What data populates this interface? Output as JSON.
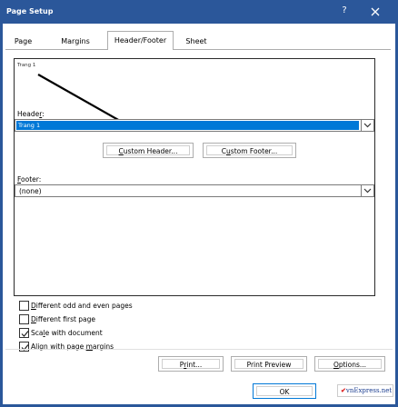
{
  "window": {
    "title": "Page Setup",
    "help_glyph": "?"
  },
  "tabs": [
    {
      "label": "Page"
    },
    {
      "label": "Margins"
    },
    {
      "label": "Header/Footer"
    },
    {
      "label": "Sheet"
    }
  ],
  "header": {
    "preview_text": "Trang 1",
    "label_prefix": "Heade",
    "label_accel": "r",
    "label_suffix": ":",
    "selected_value": "Trang 1"
  },
  "buttons": {
    "custom_header_accel": "C",
    "custom_header_rest": "ustom Header...",
    "custom_footer_prefix": "C",
    "custom_footer_accel": "u",
    "custom_footer_rest": "stom Footer...",
    "print_prefix": "P",
    "print_accel": "r",
    "print_rest": "int...",
    "print_preview": "Print Preview",
    "options_accel": "O",
    "options_rest": "ptions...",
    "ok": "OK"
  },
  "footer": {
    "label_accel": "F",
    "label_rest": "ooter:",
    "value": "(none)"
  },
  "options": [
    {
      "label_accel": "D",
      "label_rest": "ifferent odd and even pages",
      "checked": false
    },
    {
      "label_accel": "D",
      "label_rest": "ifferent first page",
      "checked": false
    },
    {
      "label_prefix": "Sca",
      "label_accel": "l",
      "label_rest": "e with document",
      "checked": true
    },
    {
      "label_prefix": "Align with page ",
      "label_accel": "m",
      "label_rest": "argins",
      "checked": true
    }
  ],
  "watermark": {
    "text": "vnExpress.net"
  },
  "colors": {
    "titlebar": "#2b579a",
    "selection": "#0078d7",
    "arrow": "#000000"
  }
}
